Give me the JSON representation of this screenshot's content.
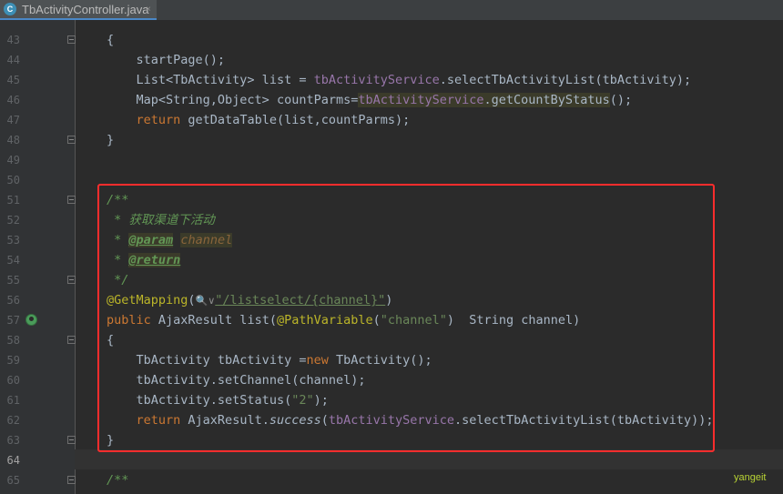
{
  "tab": {
    "icon": "C",
    "title": "TbActivityController.java",
    "close": "×"
  },
  "watermark": "yangeit",
  "code": {
    "l43": {
      "num": "43",
      "text": "{"
    },
    "l44": {
      "num": "44",
      "text": "startPage();"
    },
    "l45": {
      "num": "45",
      "a": "List<TbActivity> list = ",
      "field": "tbActivityService",
      "b": ".selectTbActivityList(tbActivity);"
    },
    "l46": {
      "num": "46",
      "a": "Map<String,Object> countParms=",
      "field": "tbActivityService",
      "b": ".getCountByStatus",
      "c": "();"
    },
    "l47": {
      "num": "47",
      "kw": "return ",
      "b": "getDataTable(list,countParms);"
    },
    "l48": {
      "num": "48",
      "text": "}"
    },
    "l49": {
      "num": "49"
    },
    "l50": {
      "num": "50"
    },
    "l51": {
      "num": "51",
      "text": "/**"
    },
    "l52": {
      "num": "52",
      "star": " * ",
      "text": "获取渠道下活动"
    },
    "l53": {
      "num": "53",
      "star": " * ",
      "tag": "@param",
      "param": "channel"
    },
    "l54": {
      "num": "54",
      "star": " * ",
      "tag": "@return"
    },
    "l55": {
      "num": "55",
      "text": " */"
    },
    "l56": {
      "num": "56",
      "ann": "@GetMapping",
      "open": "(",
      "hint": "🔍∨",
      "str": "\"/listselect/{channel}\"",
      "close": ")"
    },
    "l57": {
      "num": "57",
      "kw": "public ",
      "a": "AjaxResult list(",
      "ann": "@PathVariable",
      "b": "(",
      "str": "\"channel\"",
      "c": ")  String channel)"
    },
    "l58": {
      "num": "58",
      "text": "{"
    },
    "l59": {
      "num": "59",
      "a": "TbActivity tbActivity =",
      "kw": "new ",
      "b": "TbActivity();"
    },
    "l60": {
      "num": "60",
      "text": "tbActivity.setChannel(channel);"
    },
    "l61": {
      "num": "61",
      "a": "tbActivity.setStatus(",
      "str": "\"2\"",
      "b": ");"
    },
    "l62": {
      "num": "62",
      "kw": "return ",
      "a": "AjaxResult.",
      "ital": "success",
      "b": "(",
      "field": "tbActivityService",
      "c": ".selectTbActivityList(tbActivity));"
    },
    "l63": {
      "num": "63",
      "text": "}"
    },
    "l64": {
      "num": "64"
    },
    "l65": {
      "num": "65",
      "text": "/**"
    }
  }
}
